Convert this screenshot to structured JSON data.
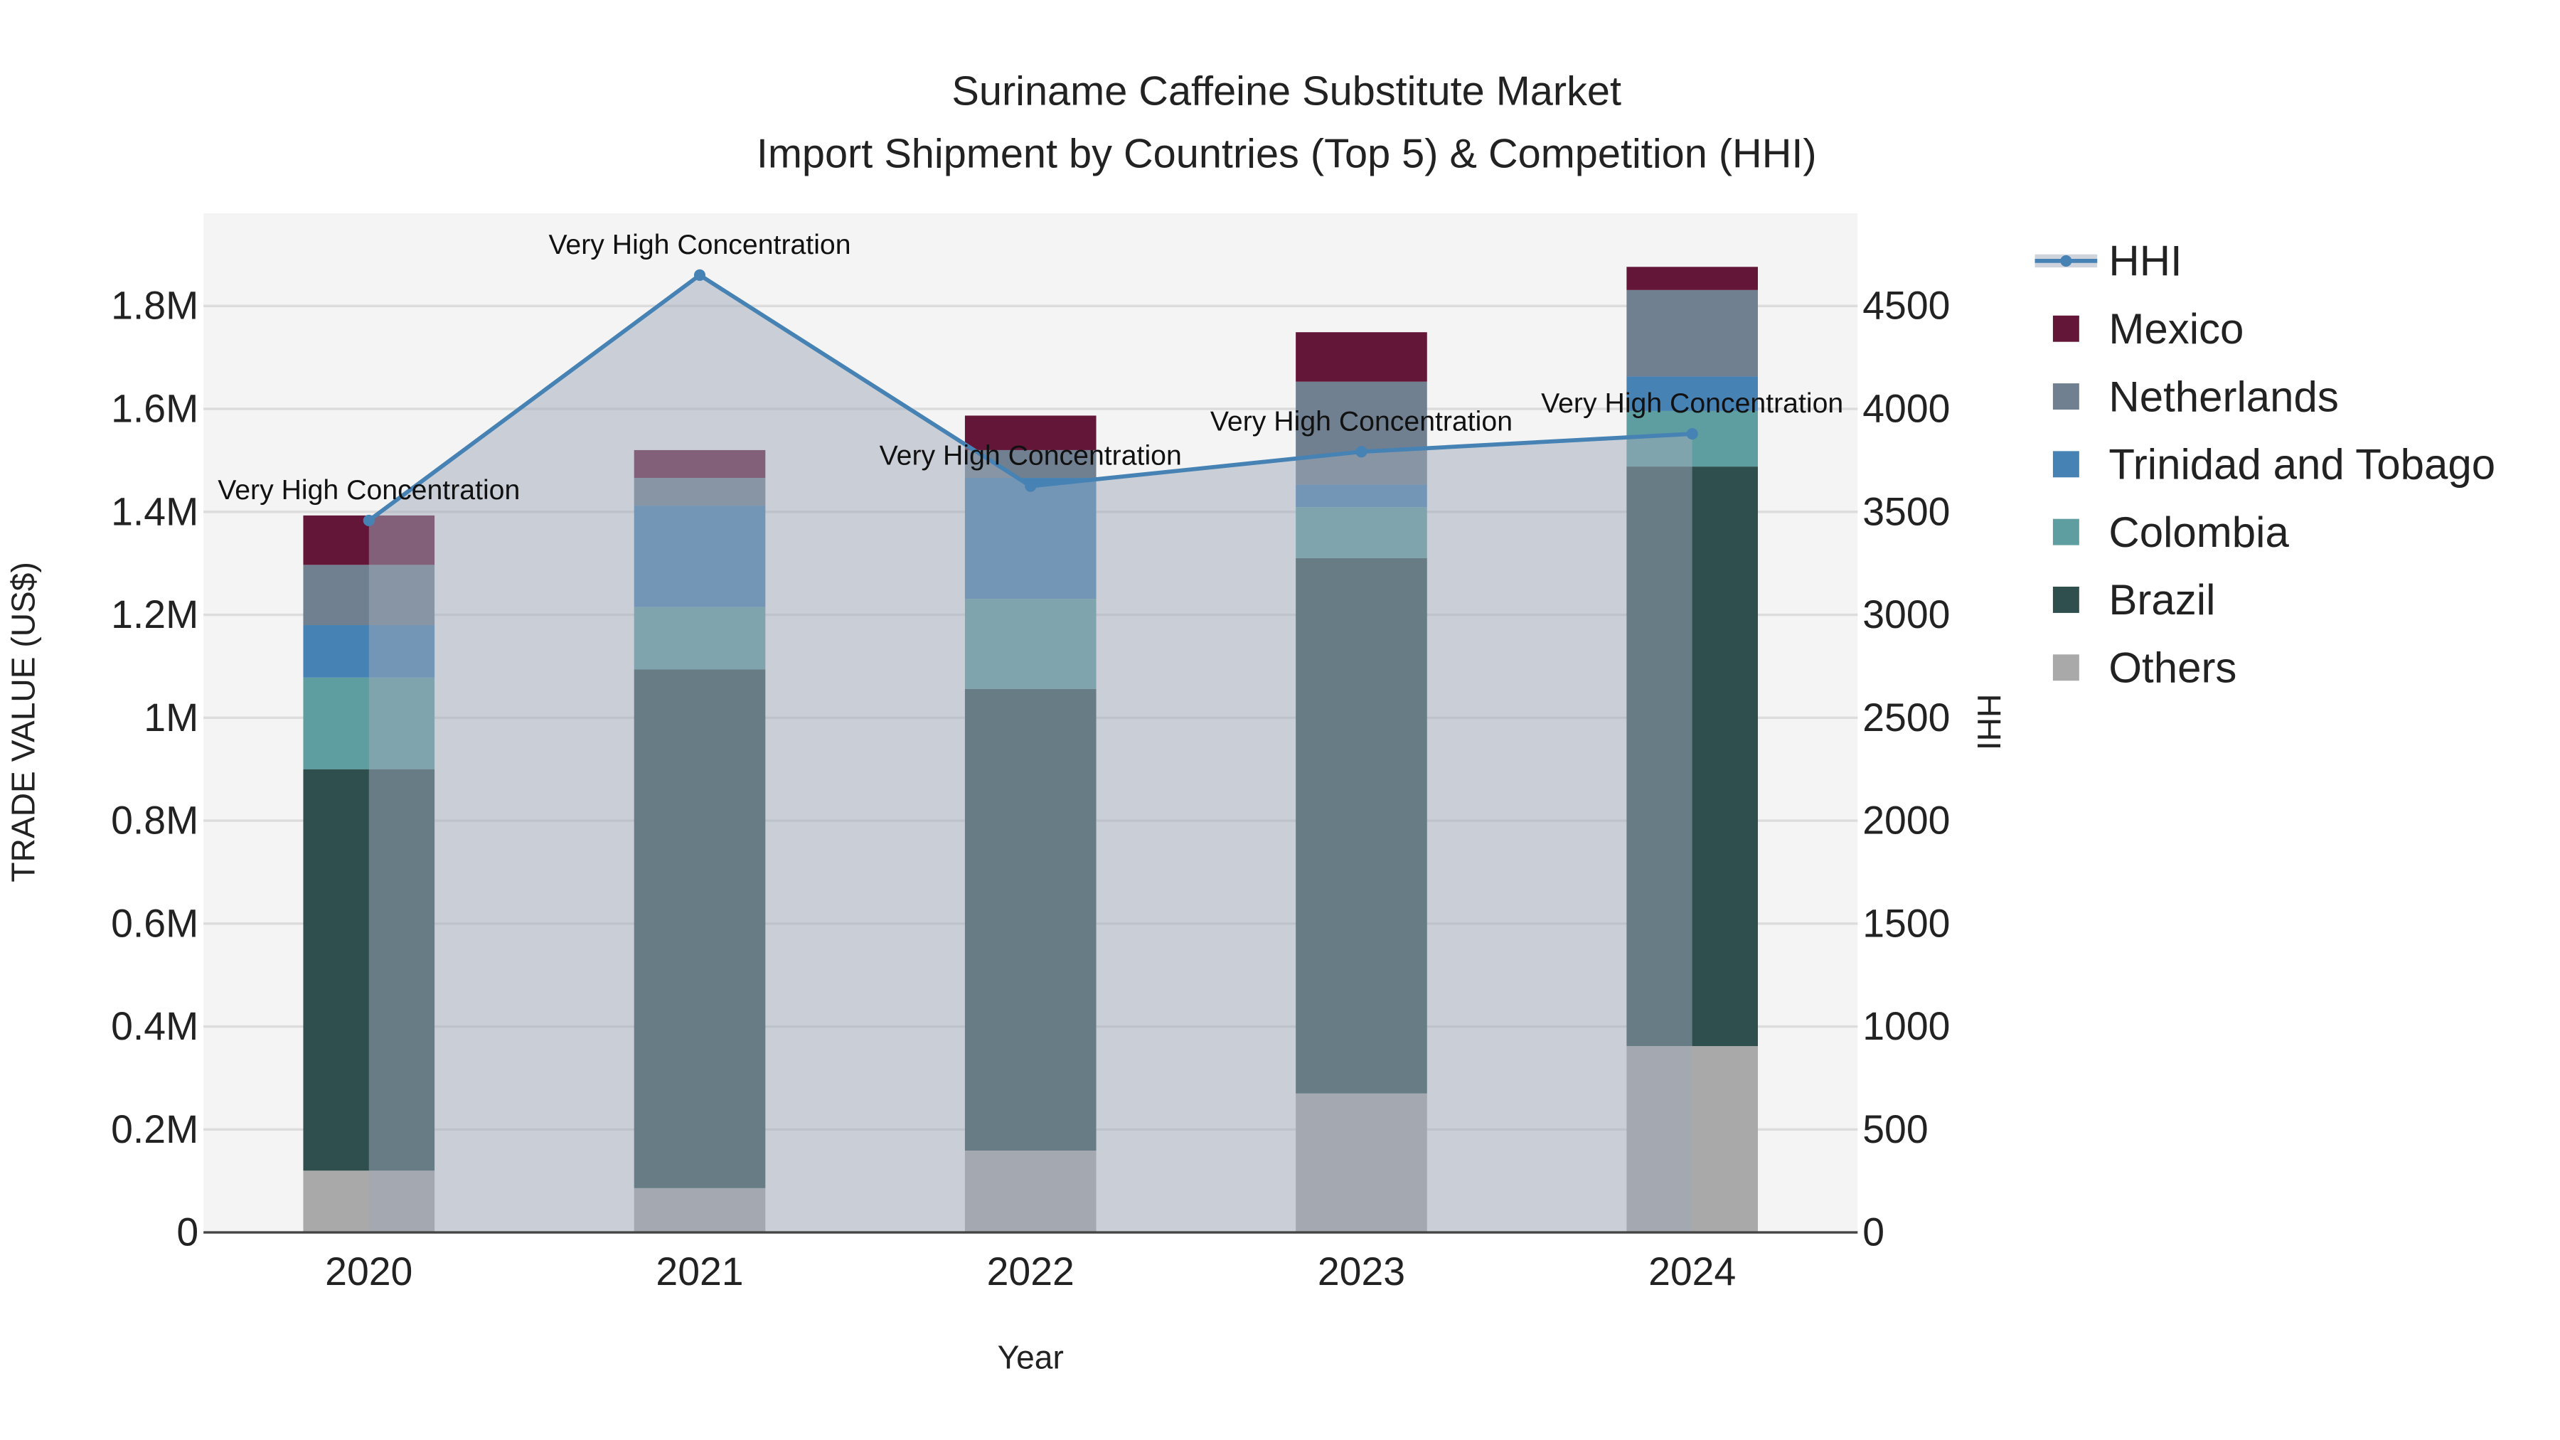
{
  "chart_data": {
    "type": "bar",
    "title": "Suriname Caffeine Substitute Market",
    "subtitle": "Import Shipment by Countries (Top 5) & Competition (HHI)",
    "xlabel": "Year",
    "ylabel": "TRADE VALUE (US$)",
    "y2label": "HHI",
    "categories": [
      "2020",
      "2021",
      "2022",
      "2023",
      "2024"
    ],
    "stacked": true,
    "ylim": [
      0,
      1980000
    ],
    "y_ticks": [
      0,
      200000,
      400000,
      600000,
      800000,
      1000000,
      1200000,
      1400000,
      1600000,
      1800000
    ],
    "y_tick_labels": [
      "0",
      "0.2M",
      "0.4M",
      "0.6M",
      "0.8M",
      "1M",
      "1.2M",
      "1.4M",
      "1.6M",
      "1.8M"
    ],
    "y2lim": [
      0,
      4950
    ],
    "y2_ticks": [
      0,
      500,
      1000,
      1500,
      2000,
      2500,
      3000,
      3500,
      4000,
      4500
    ],
    "y2_tick_labels": [
      "0",
      "500",
      "1000",
      "1500",
      "2000",
      "2500",
      "3000",
      "3500",
      "4000",
      "4500"
    ],
    "series": [
      {
        "name": "Others",
        "color": "#A9A9A9",
        "values": [
          120000,
          86000,
          159000,
          270000,
          362000
        ]
      },
      {
        "name": "Brazil",
        "color": "#2F4F4F",
        "values": [
          780000,
          1008000,
          897000,
          1040000,
          1126000
        ]
      },
      {
        "name": "Colombia",
        "color": "#5F9EA0",
        "values": [
          178000,
          121000,
          175000,
          99000,
          108000
        ]
      },
      {
        "name": "Trinidad and Tobago",
        "color": "#4682B4",
        "values": [
          102000,
          197000,
          235000,
          44000,
          67000
        ]
      },
      {
        "name": "Netherlands",
        "color": "#708090",
        "values": [
          117000,
          54000,
          54000,
          200000,
          168000
        ]
      },
      {
        "name": "Mexico",
        "color": "#641638",
        "values": [
          96000,
          54000,
          67000,
          96000,
          45000
        ]
      }
    ],
    "line_series": {
      "name": "HHI",
      "axis": "y2",
      "color": "#4682B4",
      "values": [
        3458,
        4650,
        3625,
        3792,
        3879
      ],
      "annotations": [
        "Very High Concentration",
        "Very High Concentration",
        "Very High Concentration",
        "Very High Concentration",
        "Very High Concentration"
      ]
    },
    "legend_order": [
      "HHI",
      "Mexico",
      "Netherlands",
      "Trinidad and Tobago",
      "Colombia",
      "Brazil",
      "Others"
    ],
    "legend_position": "right",
    "grid": true
  }
}
